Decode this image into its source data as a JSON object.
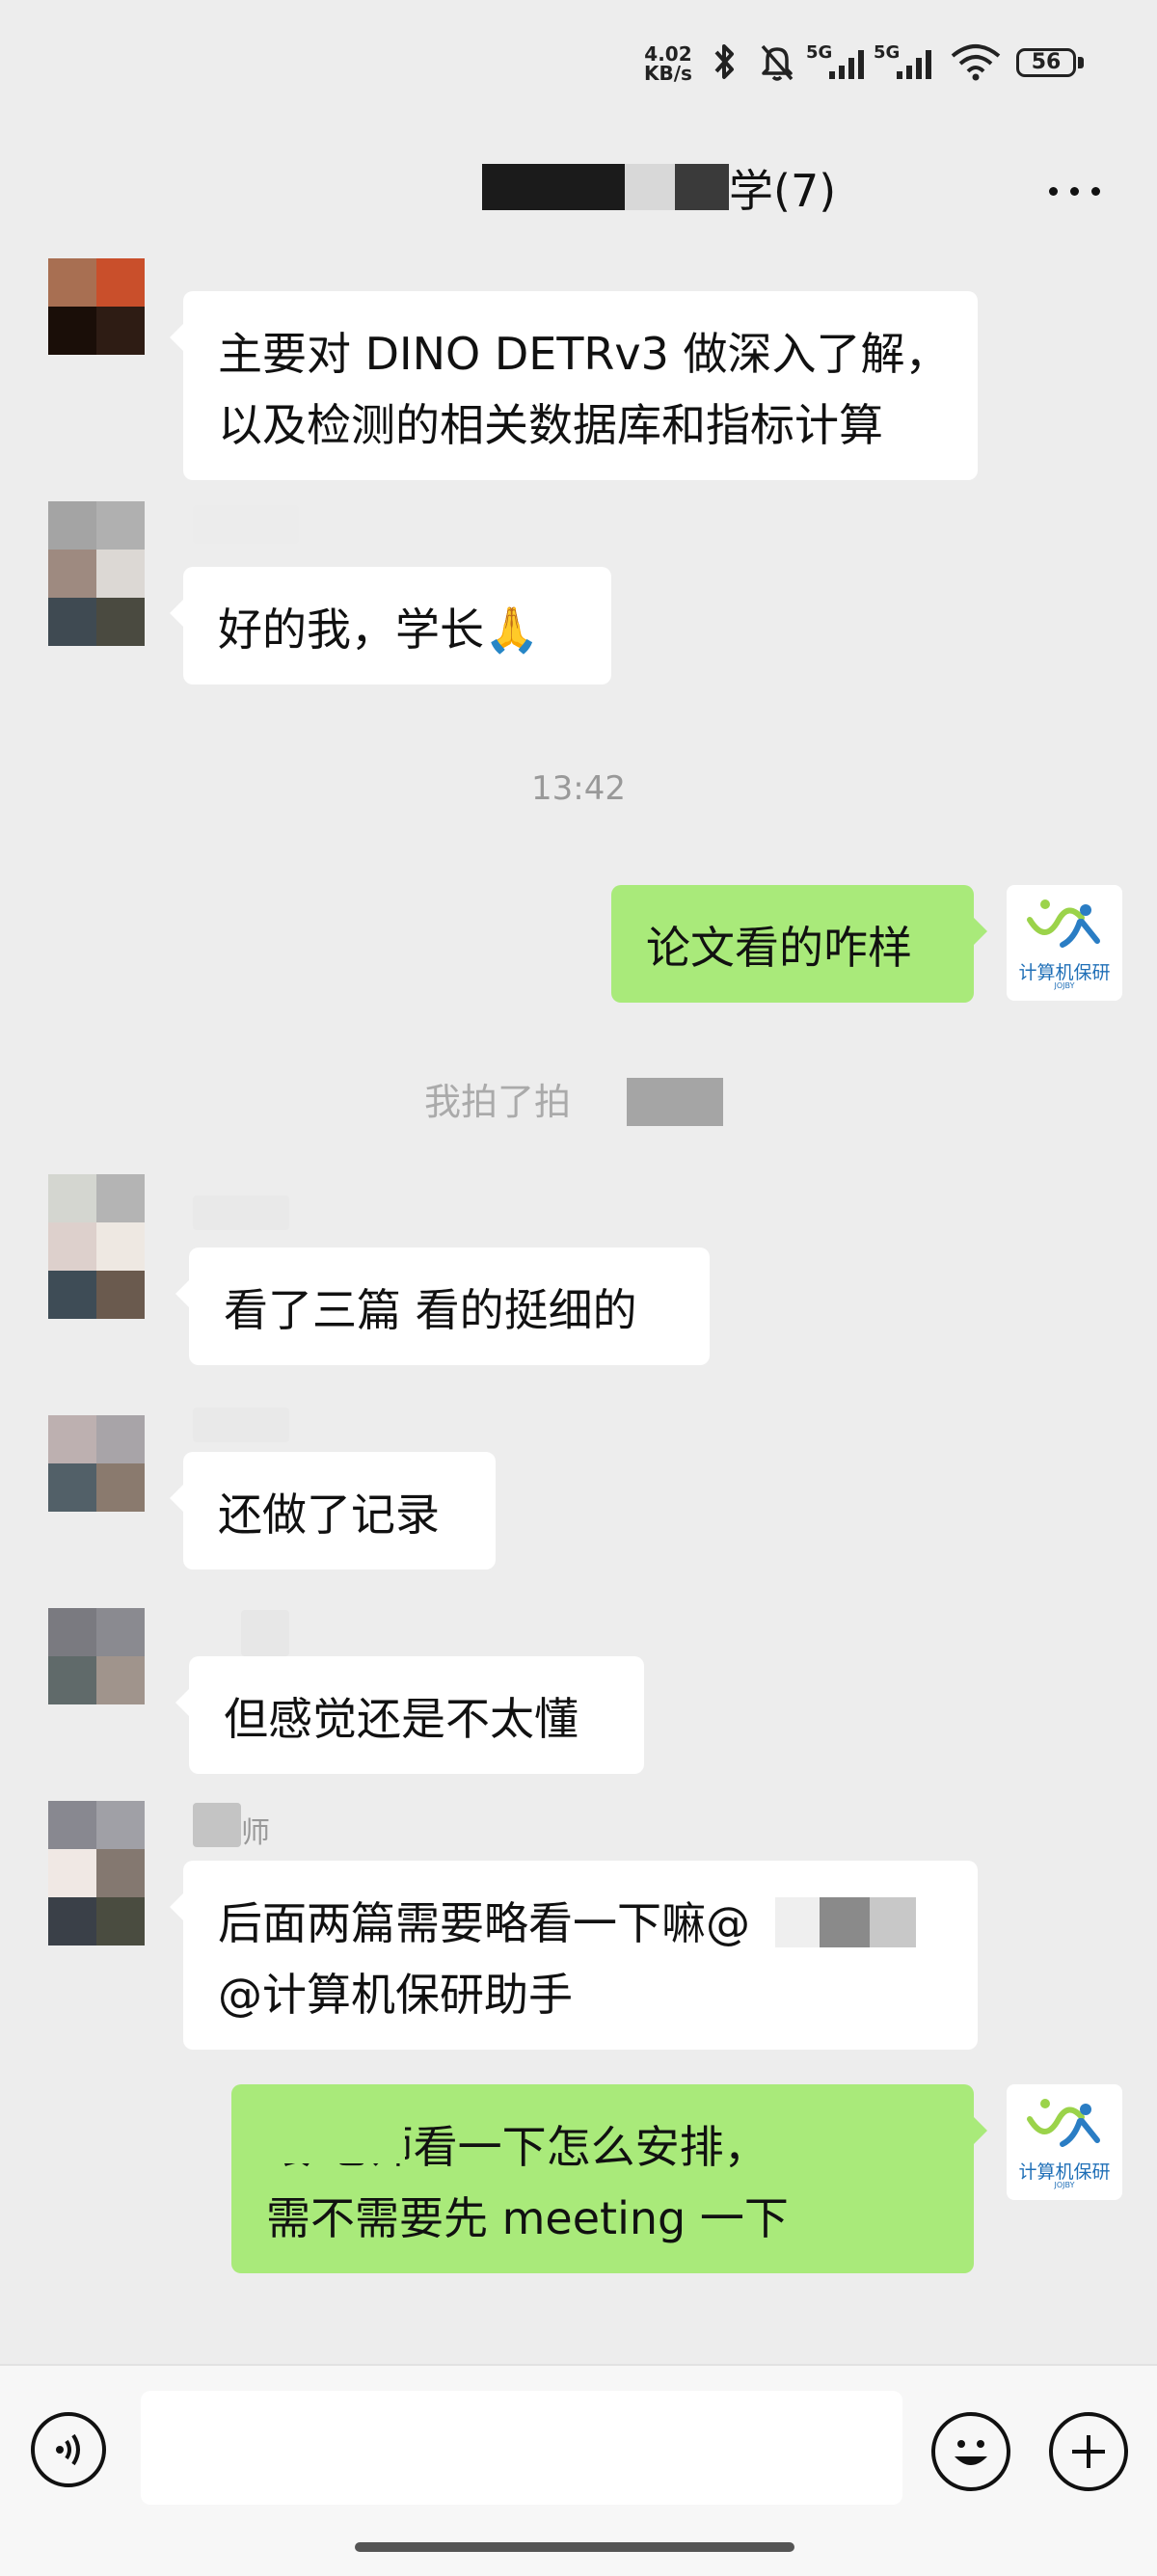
{
  "status_bar": {
    "network_speed": "4.02\nKB/s",
    "network_speed_line1": "4.02",
    "network_speed_line2": "KB/s",
    "signal1": "5G",
    "signal2": "5G",
    "battery": "56",
    "icons": [
      "bluetooth-icon",
      "mute-bell-icon",
      "signal-icon",
      "signal-icon",
      "wifi-icon",
      "battery-icon"
    ]
  },
  "header": {
    "title_visible": "学(7)",
    "more_icon": "more-dots-icon"
  },
  "messages": [
    {
      "side": "left",
      "lines": [
        "主要对 DINO DETRv3 做深入了解，",
        "以及检测的相关数据库和指标计算"
      ]
    },
    {
      "side": "left",
      "lines": [
        "好的我，学长🙏"
      ]
    },
    {
      "type": "time",
      "text": "13:42"
    },
    {
      "side": "right",
      "lines": [
        "论文看的咋样"
      ]
    },
    {
      "type": "system",
      "text": "我拍了拍"
    },
    {
      "side": "left",
      "lines": [
        "看了三篇 看的挺细的"
      ]
    },
    {
      "side": "left",
      "lines": [
        "还做了记录"
      ]
    },
    {
      "side": "left",
      "lines": [
        "但感觉还是不太懂"
      ]
    },
    {
      "side": "left",
      "sender_suffix": "师",
      "lines": [
        "后面两篇需要略看一下嘛@",
        "@计算机保研助手"
      ]
    },
    {
      "side": "right",
      "lines": [
        "喂  老师看一下怎么安排，",
        "需不需要先 meeting 一下"
      ]
    }
  ],
  "bot": {
    "label": "计算机保研",
    "sub": "JOJBY"
  },
  "input_bar": {
    "placeholder": "",
    "voice_icon": "voice-icon",
    "emoji_icon": "emoji-icon",
    "plus_icon": "plus-icon"
  },
  "colors": {
    "background": "#ededed",
    "left_bubble": "#ffffff",
    "right_bubble": "#a9ea7a",
    "bot_text": "#1f6fb7"
  }
}
